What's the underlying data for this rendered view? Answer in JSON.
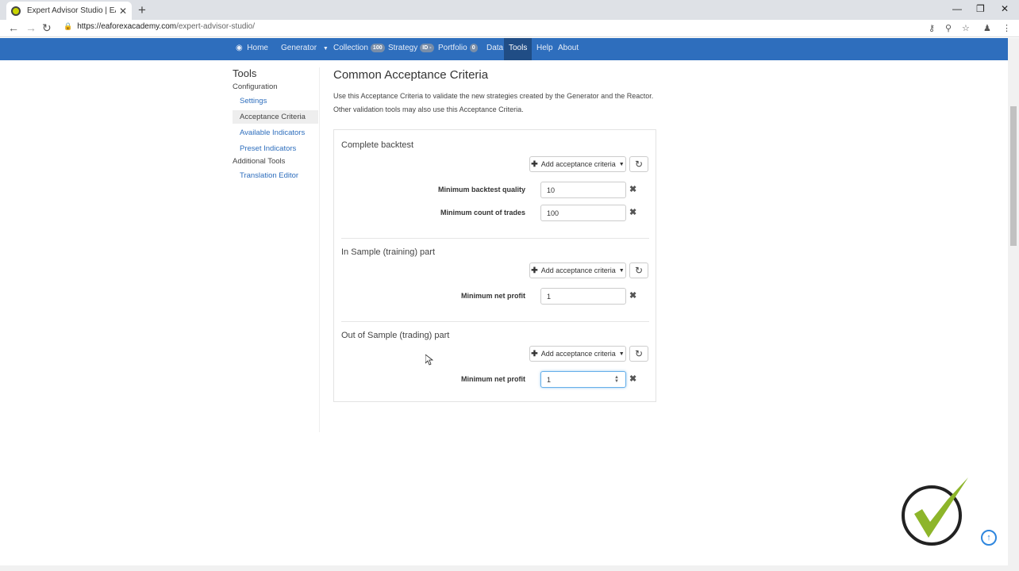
{
  "browser": {
    "tab_title": "Expert Advisor Studio | EA Forex",
    "tab_close": "✕",
    "new_tab": "+",
    "url_host": "https://eaforexacademy.com",
    "url_path": "/expert-advisor-studio/",
    "icons": [
      "favicon-icon",
      "back-icon",
      "forward-icon",
      "reload-icon",
      "lock-icon",
      "key-icon",
      "zoom-icon",
      "star-icon",
      "profile-icon",
      "menu-icon",
      "minimize-icon",
      "restore-icon",
      "close-icon"
    ]
  },
  "nav": {
    "home": "Home",
    "generator": "Generator",
    "collection": "Collection",
    "collection_badge": "100",
    "strategy": "Strategy",
    "strategy_badge": "ID -",
    "portfolio": "Portfolio",
    "portfolio_badge": "0",
    "data": "Data",
    "tools": "Tools",
    "help": "Help",
    "about": "About",
    "active": "Tools"
  },
  "sidebar": {
    "title": "Tools",
    "configuration": "Configuration",
    "settings": "Settings",
    "acceptance_criteria": "Acceptance Criteria",
    "available_indicators": "Available Indicators",
    "preset_indicators": "Preset Indicators",
    "additional_tools": "Additional Tools",
    "translation_editor": "Translation Editor"
  },
  "main": {
    "title": "Common Acceptance Criteria",
    "desc1": "Use this Acceptance Criteria to validate the new strategies created by the Generator and the Reactor.",
    "desc2": "Other validation tools may also use this Acceptance Criteria.",
    "add_label": "Add acceptance criteria",
    "sections": [
      {
        "title": "Complete backtest",
        "criteria": [
          {
            "label": "Minimum backtest quality",
            "value": "10"
          },
          {
            "label": "Minimum count of trades",
            "value": "100"
          }
        ]
      },
      {
        "title": "In Sample (training) part",
        "criteria": [
          {
            "label": "Minimum net profit",
            "value": "1"
          }
        ]
      },
      {
        "title": "Out of Sample (trading) part",
        "criteria": [
          {
            "label": "Minimum net profit",
            "value": "1"
          }
        ]
      }
    ]
  },
  "colors": {
    "nav_bg": "#2e6ebd",
    "nav_active": "#204d85",
    "link": "#2e6ebd",
    "logo_green": "#8db52a"
  }
}
